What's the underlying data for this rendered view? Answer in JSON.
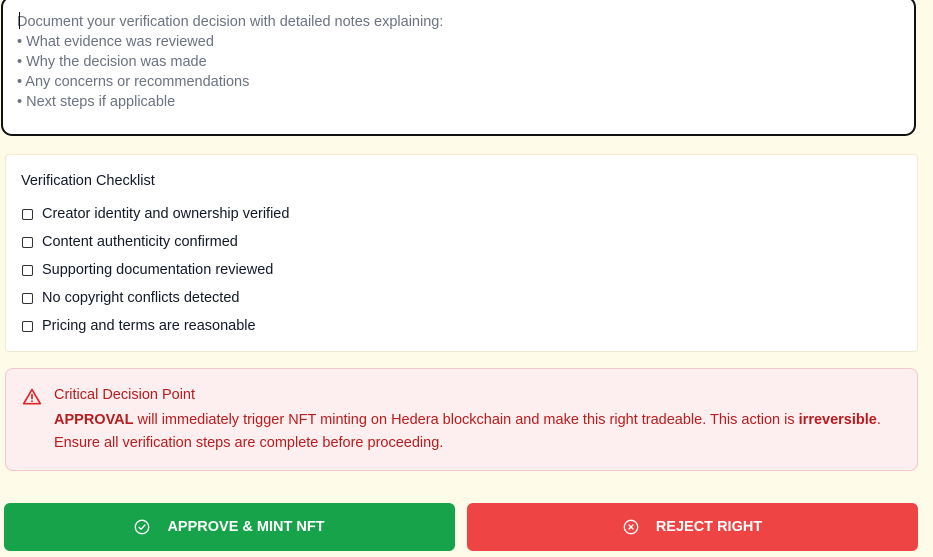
{
  "notes": {
    "placeholder": "Document your verification decision with detailed notes explaining:\n• What evidence was reviewed\n• Why the decision was made\n• Any concerns or recommendations\n• Next steps if applicable",
    "value": ""
  },
  "checklist": {
    "title": "Verification Checklist",
    "items": [
      {
        "label": "Creator identity and ownership verified",
        "checked": false
      },
      {
        "label": "Content authenticity confirmed",
        "checked": false
      },
      {
        "label": "Supporting documentation reviewed",
        "checked": false
      },
      {
        "label": "No copyright conflicts detected",
        "checked": false
      },
      {
        "label": "Pricing and terms are reasonable",
        "checked": false
      }
    ]
  },
  "alert": {
    "icon": "warning-triangle-icon",
    "title": "Critical Decision Point",
    "body_bold_1": "APPROVAL",
    "body_text_1": " will immediately trigger NFT minting on Hedera blockchain and make this right tradeable. This action is ",
    "body_bold_2": "irreversible",
    "body_text_2": ". Ensure all verification steps are complete before proceeding.",
    "color": "#b91c1c",
    "background": "#fdeef0"
  },
  "actions": {
    "approve": {
      "label": "APPROVE & MINT NFT",
      "icon": "check-circle-icon",
      "color": "#16a34a"
    },
    "reject": {
      "label": "REJECT RIGHT",
      "icon": "x-circle-icon",
      "color": "#ef4444"
    }
  }
}
